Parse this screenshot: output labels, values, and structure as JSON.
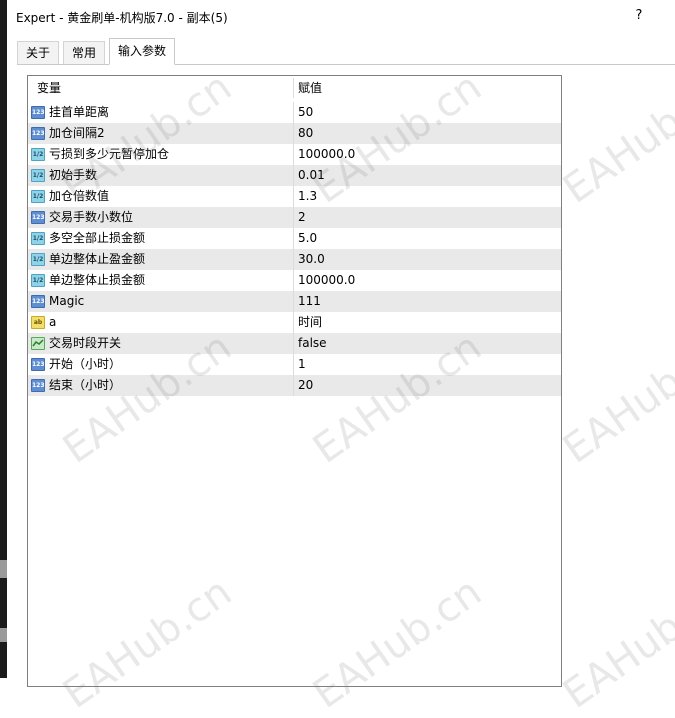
{
  "window": {
    "title": "Expert - 黄金刷单-机构版7.0 - 副本(5)",
    "help": "?"
  },
  "tabs": [
    {
      "label": "关于"
    },
    {
      "label": "常用"
    },
    {
      "label": "输入参数",
      "active": true
    }
  ],
  "grid": {
    "columns": {
      "name": "变量",
      "value": "赋值"
    },
    "rows": [
      {
        "type": "int",
        "type_icon": "123",
        "name": "挂首单距离",
        "value": "50"
      },
      {
        "type": "int",
        "type_icon": "123",
        "name": "加仓间隔2",
        "value": "80"
      },
      {
        "type": "double",
        "type_icon": "1/2",
        "name": "亏损到多少元暂停加仓",
        "value": "100000.0"
      },
      {
        "type": "double",
        "type_icon": "1/2",
        "name": "初始手数",
        "value": "0.01"
      },
      {
        "type": "double",
        "type_icon": "1/2",
        "name": "加仓倍数值",
        "value": "1.3"
      },
      {
        "type": "int",
        "type_icon": "123",
        "name": "交易手数小数位",
        "value": "2"
      },
      {
        "type": "double",
        "type_icon": "1/2",
        "name": "多空全部止损金额",
        "value": "5.0"
      },
      {
        "type": "double",
        "type_icon": "1/2",
        "name": "单边整体止盈金额",
        "value": "30.0"
      },
      {
        "type": "double",
        "type_icon": "1/2",
        "name": "单边整体止损金额",
        "value": "100000.0"
      },
      {
        "type": "int",
        "type_icon": "123",
        "name": "Magic",
        "value": "111"
      },
      {
        "type": "string",
        "type_icon": "ab",
        "name": "a",
        "value": "时间"
      },
      {
        "type": "bool",
        "type_icon": "",
        "name": "交易时段开关",
        "value": "false"
      },
      {
        "type": "int",
        "type_icon": "123",
        "name": "开始（小时）",
        "value": "1"
      },
      {
        "type": "int",
        "type_icon": "123",
        "name": "结束（小时）",
        "value": "20"
      }
    ]
  },
  "watermark": {
    "text": "EAHub.cn"
  }
}
